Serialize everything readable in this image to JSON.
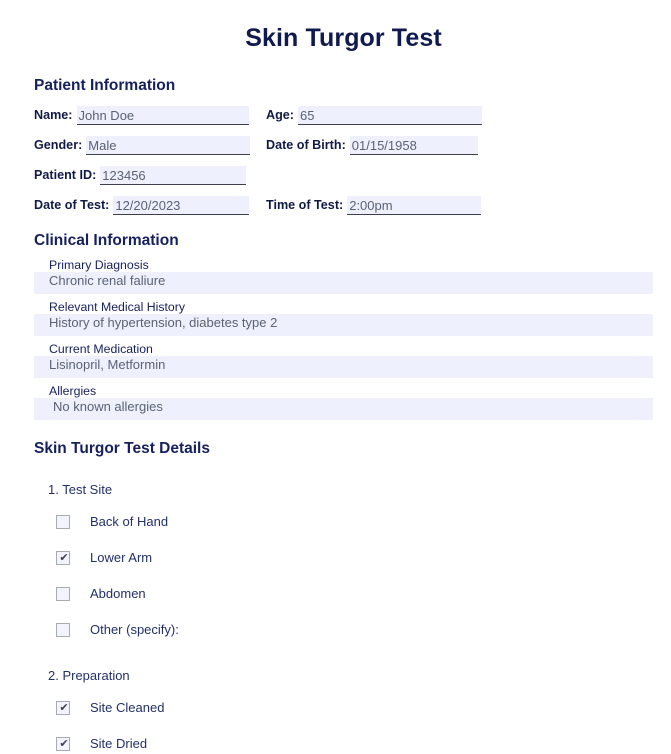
{
  "document": {
    "title": "Skin Turgor Test"
  },
  "patient_information": {
    "heading": "Patient Information",
    "fields": [
      {
        "label": "Name:",
        "value": "John Doe"
      },
      {
        "label": "Age:",
        "value": "65"
      },
      {
        "label": "Gender:",
        "value": "Male"
      },
      {
        "label": "Date of Birth:",
        "value": "01/15/1958"
      },
      {
        "label": "Patient ID:",
        "value": "123456"
      },
      {
        "label": "Date of Test:",
        "value": "12/20/2023"
      },
      {
        "label": "Time of Test:",
        "value": "2:00pm"
      }
    ]
  },
  "clinical_information": {
    "heading": "Clinical Information",
    "rows": [
      {
        "label": "Primary Diagnosis",
        "value": "Chronic renal faliure"
      },
      {
        "label": "Relevant Medical History",
        "value": "History of hypertension, diabetes type 2"
      },
      {
        "label": "Current Medication",
        "value": "Lisinopril, Metformin"
      },
      {
        "label": "Allergies",
        "value": "No known allergies"
      }
    ]
  },
  "test_details": {
    "heading": "Skin Turgor Test Details",
    "questions": [
      {
        "title": "1. Test Site",
        "options": [
          {
            "label": "Back of Hand",
            "checked": false
          },
          {
            "label": "Lower Arm",
            "checked": true
          },
          {
            "label": "Abdomen",
            "checked": false
          },
          {
            "label": "Other (specify):",
            "checked": false
          }
        ]
      },
      {
        "title": "2. Preparation",
        "options": [
          {
            "label": "Site Cleaned",
            "checked": true
          },
          {
            "label": "Site Dried",
            "checked": true
          }
        ]
      }
    ]
  },
  "icons": {
    "checkmark": "✔"
  },
  "colors": {
    "title": "#111a4e",
    "heading": "#16205c",
    "field_background": "#eef0fd",
    "field_underline": "#3c3f4d",
    "value_text": "#5b6275",
    "checkbox_border": "#a9abb4"
  }
}
